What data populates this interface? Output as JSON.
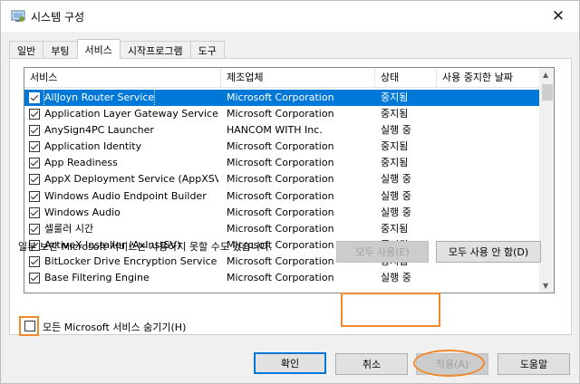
{
  "window": {
    "title": "시스템 구성",
    "close_glyph": "✕"
  },
  "tabs": [
    "일반",
    "부팅",
    "서비스",
    "시작프로그램",
    "도구"
  ],
  "listview": {
    "headers": {
      "service": "서비스",
      "manufacturer": "제조업체",
      "status": "상태",
      "date_disabled": "사용 중지한 날짜"
    },
    "rows": [
      {
        "checked": true,
        "name": "AllJoyn Router Service",
        "manufacturer": "Microsoft Corporation",
        "status": "중지됨",
        "selected": true
      },
      {
        "checked": true,
        "name": "Application Layer Gateway Service",
        "manufacturer": "Microsoft Corporation",
        "status": "중지됨"
      },
      {
        "checked": true,
        "name": "AnySign4PC Launcher",
        "manufacturer": "HANCOM WITH Inc.",
        "status": "실행 중"
      },
      {
        "checked": true,
        "name": "Application Identity",
        "manufacturer": "Microsoft Corporation",
        "status": "중지됨"
      },
      {
        "checked": true,
        "name": "App Readiness",
        "manufacturer": "Microsoft Corporation",
        "status": "중지됨"
      },
      {
        "checked": true,
        "name": "AppX Deployment Service (AppXSV...",
        "manufacturer": "Microsoft Corporation",
        "status": "실행 중"
      },
      {
        "checked": true,
        "name": "Windows Audio Endpoint Builder",
        "manufacturer": "Microsoft Corporation",
        "status": "실행 중"
      },
      {
        "checked": true,
        "name": "Windows Audio",
        "manufacturer": "Microsoft Corporation",
        "status": "실행 중"
      },
      {
        "checked": true,
        "name": "셀룰러 시간",
        "manufacturer": "Microsoft Corporation",
        "status": "중지됨"
      },
      {
        "checked": true,
        "name": "ActiveX Installer (AxInstSV)",
        "manufacturer": "Microsoft Corporation",
        "status": "중지됨"
      },
      {
        "checked": true,
        "name": "BitLocker Drive Encryption Service",
        "manufacturer": "Microsoft Corporation",
        "status": "중지됨"
      },
      {
        "checked": true,
        "name": "Base Filtering Engine",
        "manufacturer": "Microsoft Corporation",
        "status": "실행 중"
      }
    ]
  },
  "note": "일부 보안 Microsoft 서비스는 사용하지 못할 수도 있습니다.",
  "buttons": {
    "enable_all": "모두 사용(E)",
    "disable_all": "모두 사용 안 함(D)",
    "ok": "확인",
    "cancel": "취소",
    "apply": "적용(A)",
    "help": "도움말"
  },
  "hide_ms": {
    "label": "모든 Microsoft 서비스 숨기기(H)",
    "checked": false
  },
  "colors": {
    "selection": "#0078d7",
    "highlight": "#f08a2c"
  }
}
